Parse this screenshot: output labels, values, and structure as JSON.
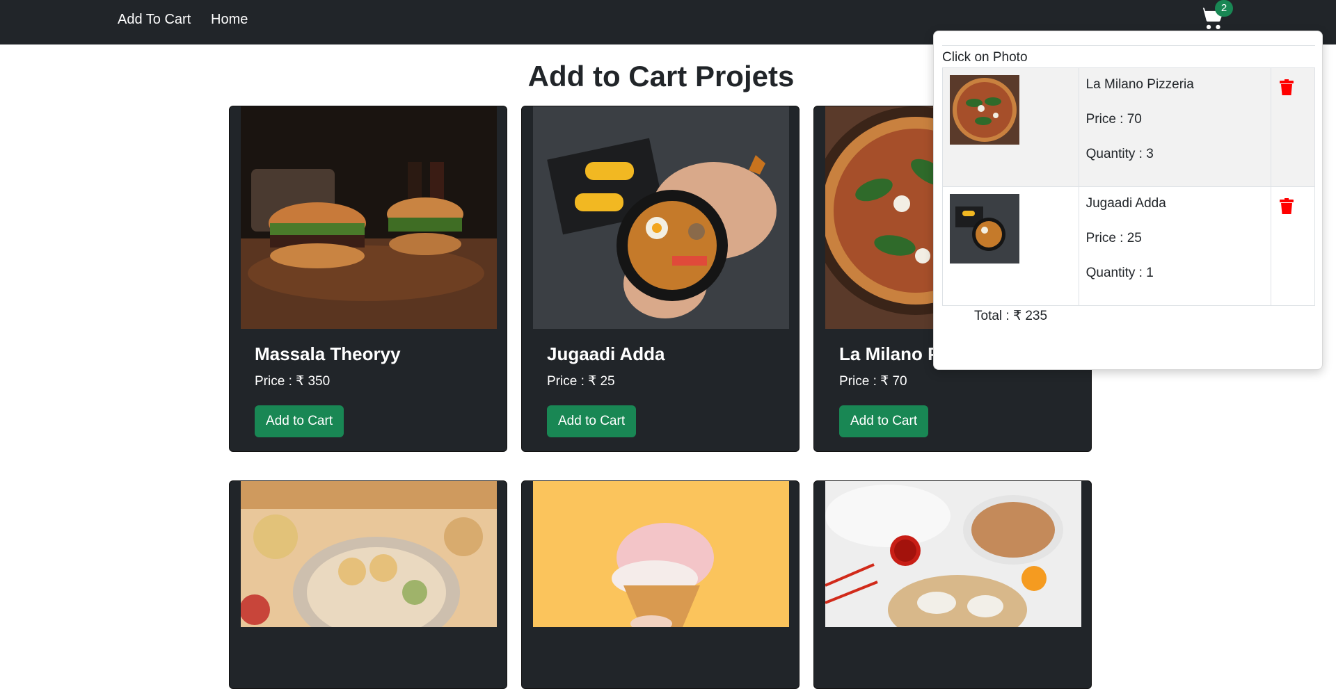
{
  "navbar": {
    "brand": "Add To Cart",
    "home": "Home",
    "cart_count": "2"
  },
  "title": "Add to Cart Projets",
  "cards": [
    {
      "name": "Massala Theoryy",
      "price": "Price : ₹ 350",
      "button": "Add to Cart"
    },
    {
      "name": "Jugaadi Adda",
      "price": "Price : ₹ 25",
      "button": "Add to Cart"
    },
    {
      "name": "La Milano Pizzeria",
      "price": "Price : ₹ 70",
      "button": "Add to Cart"
    }
  ],
  "cart": {
    "hint": "Click on Photo",
    "items": [
      {
        "name": "La Milano Pizzeria",
        "price": "Price : 70",
        "quantity": "Quantity : 3"
      },
      {
        "name": "Jugaadi Adda",
        "price": "Price : 25",
        "quantity": "Quantity : 1"
      }
    ],
    "total": "Total : ₹ 235"
  },
  "colors": {
    "navbar": "#212529",
    "accent": "#198754",
    "delete": "#ff0000"
  }
}
